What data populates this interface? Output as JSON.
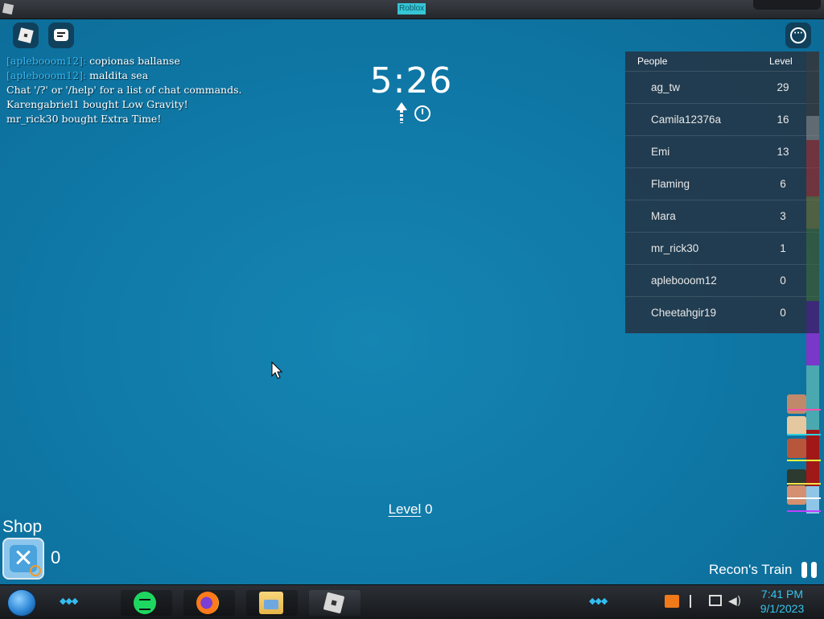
{
  "window": {
    "title": "Roblox"
  },
  "topbar": {
    "roblox_menu_icon": "roblox-logo-icon",
    "chat_icon": "chat-icon",
    "more_icon": "more-options-icon"
  },
  "chat": {
    "lines": [
      {
        "who": "[aplebooom12]:",
        "text": "copionas ballanse"
      },
      {
        "who": "[aplebooom12]:",
        "text": "maldita sea"
      },
      {
        "who": "",
        "text": "Chat '/?' or '/help' for a list of chat commands."
      },
      {
        "who": "",
        "text": "Karengabriel1 bought Low Gravity!"
      },
      {
        "who": "",
        "text": "mr_rick30 bought Extra Time!"
      }
    ]
  },
  "timer": {
    "value": "5:26"
  },
  "leaderboard": {
    "col_people": "People",
    "col_level": "Level",
    "rows": [
      {
        "name": "ag_tw",
        "level": "29"
      },
      {
        "name": "Camila12376a",
        "level": "16"
      },
      {
        "name": "Emi",
        "level": "13"
      },
      {
        "name": "Flaming",
        "level": "6"
      },
      {
        "name": "Mara",
        "level": "3"
      },
      {
        "name": "mr_rick30",
        "level": "1"
      },
      {
        "name": "aplebooom12",
        "level": "0"
      },
      {
        "name": "Cheetahgir19",
        "level": "0"
      }
    ]
  },
  "hud": {
    "level_word": "Level",
    "level_value": "0",
    "shop_label": "Shop",
    "shop_count": "0",
    "train_label": "Recon's Train"
  },
  "taskbar": {
    "time": "7:41 PM",
    "date": "9/1/2023",
    "apps": [
      "spotify-icon",
      "firefox-icon",
      "file-explorer-icon",
      "roblox-icon"
    ]
  },
  "colors": {
    "background": "#1382b0",
    "chat_name": "#3ab7f0",
    "taskbar_text": "#33c6f0"
  }
}
